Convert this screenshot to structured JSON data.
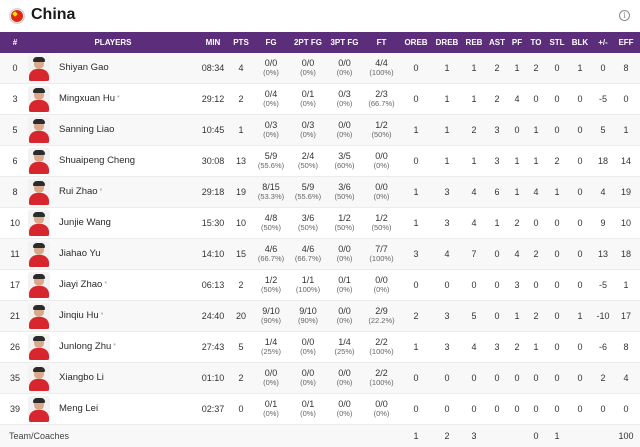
{
  "team": {
    "name": "China",
    "flag_color": "#de2910"
  },
  "columns": [
    "#",
    "PLAYERS",
    "MIN",
    "PTS",
    "FG",
    "2PT FG",
    "3PT FG",
    "FT",
    "OREB",
    "DREB",
    "REB",
    "AST",
    "PF",
    "TO",
    "STL",
    "BLK",
    "+/-",
    "EFF"
  ],
  "players": [
    {
      "num": "0",
      "name": "Shiyan Gao",
      "starter": false,
      "min": "08:34",
      "pts": "4",
      "fg": "0/0",
      "fg_pct": "(0%)",
      "fg2": "0/0",
      "fg2_pct": "(0%)",
      "fg3": "0/0",
      "fg3_pct": "(0%)",
      "ft": "4/4",
      "ft_pct": "(100%)",
      "oreb": "0",
      "dreb": "1",
      "reb": "1",
      "ast": "2",
      "pf": "1",
      "to": "2",
      "stl": "0",
      "blk": "1",
      "pm": "0",
      "eff": "8"
    },
    {
      "num": "3",
      "name": "Mingxuan Hu",
      "starter": true,
      "min": "29:12",
      "pts": "2",
      "fg": "0/4",
      "fg_pct": "(0%)",
      "fg2": "0/1",
      "fg2_pct": "(0%)",
      "fg3": "0/3",
      "fg3_pct": "(0%)",
      "ft": "2/3",
      "ft_pct": "(66.7%)",
      "oreb": "0",
      "dreb": "1",
      "reb": "1",
      "ast": "2",
      "pf": "4",
      "to": "0",
      "stl": "0",
      "blk": "0",
      "pm": "-5",
      "eff": "0"
    },
    {
      "num": "5",
      "name": "Sanning Liao",
      "starter": false,
      "min": "10:45",
      "pts": "1",
      "fg": "0/3",
      "fg_pct": "(0%)",
      "fg2": "0/3",
      "fg2_pct": "(0%)",
      "fg3": "0/0",
      "fg3_pct": "(0%)",
      "ft": "1/2",
      "ft_pct": "(50%)",
      "oreb": "1",
      "dreb": "1",
      "reb": "2",
      "ast": "3",
      "pf": "0",
      "to": "1",
      "stl": "0",
      "blk": "0",
      "pm": "5",
      "eff": "1"
    },
    {
      "num": "6",
      "name": "Shuaipeng Cheng",
      "starter": false,
      "min": "30:08",
      "pts": "13",
      "fg": "5/9",
      "fg_pct": "(55.6%)",
      "fg2": "2/4",
      "fg2_pct": "(50%)",
      "fg3": "3/5",
      "fg3_pct": "(60%)",
      "ft": "0/0",
      "ft_pct": "(0%)",
      "oreb": "0",
      "dreb": "1",
      "reb": "1",
      "ast": "3",
      "pf": "1",
      "to": "1",
      "stl": "2",
      "blk": "0",
      "pm": "18",
      "eff": "14"
    },
    {
      "num": "8",
      "name": "Rui Zhao",
      "starter": true,
      "min": "29:18",
      "pts": "19",
      "fg": "8/15",
      "fg_pct": "(53.3%)",
      "fg2": "5/9",
      "fg2_pct": "(55.6%)",
      "fg3": "3/6",
      "fg3_pct": "(50%)",
      "ft": "0/0",
      "ft_pct": "(0%)",
      "oreb": "1",
      "dreb": "3",
      "reb": "4",
      "ast": "6",
      "pf": "1",
      "to": "4",
      "stl": "1",
      "blk": "0",
      "pm": "4",
      "eff": "19"
    },
    {
      "num": "10",
      "name": "Junjie Wang",
      "starter": false,
      "min": "15:30",
      "pts": "10",
      "fg": "4/8",
      "fg_pct": "(50%)",
      "fg2": "3/6",
      "fg2_pct": "(50%)",
      "fg3": "1/2",
      "fg3_pct": "(50%)",
      "ft": "1/2",
      "ft_pct": "(50%)",
      "oreb": "1",
      "dreb": "3",
      "reb": "4",
      "ast": "1",
      "pf": "2",
      "to": "0",
      "stl": "0",
      "blk": "0",
      "pm": "9",
      "eff": "10"
    },
    {
      "num": "11",
      "name": "Jiahao Yu",
      "starter": false,
      "min": "14:10",
      "pts": "15",
      "fg": "4/6",
      "fg_pct": "(66.7%)",
      "fg2": "4/6",
      "fg2_pct": "(66.7%)",
      "fg3": "0/0",
      "fg3_pct": "(0%)",
      "ft": "7/7",
      "ft_pct": "(100%)",
      "oreb": "3",
      "dreb": "4",
      "reb": "7",
      "ast": "0",
      "pf": "4",
      "to": "2",
      "stl": "0",
      "blk": "0",
      "pm": "13",
      "eff": "18"
    },
    {
      "num": "17",
      "name": "Jiayi Zhao",
      "starter": true,
      "min": "06:13",
      "pts": "2",
      "fg": "1/2",
      "fg_pct": "(50%)",
      "fg2": "1/1",
      "fg2_pct": "(100%)",
      "fg3": "0/1",
      "fg3_pct": "(0%)",
      "ft": "0/0",
      "ft_pct": "(0%)",
      "oreb": "0",
      "dreb": "0",
      "reb": "0",
      "ast": "0",
      "pf": "3",
      "to": "0",
      "stl": "0",
      "blk": "0",
      "pm": "-5",
      "eff": "1"
    },
    {
      "num": "21",
      "name": "Jinqiu Hu",
      "starter": true,
      "min": "24:40",
      "pts": "20",
      "fg": "9/10",
      "fg_pct": "(90%)",
      "fg2": "9/10",
      "fg2_pct": "(90%)",
      "fg3": "0/0",
      "fg3_pct": "(0%)",
      "ft": "2/9",
      "ft_pct": "(22.2%)",
      "oreb": "2",
      "dreb": "3",
      "reb": "5",
      "ast": "0",
      "pf": "1",
      "to": "2",
      "stl": "0",
      "blk": "1",
      "pm": "-10",
      "eff": "17"
    },
    {
      "num": "26",
      "name": "Junlong Zhu",
      "starter": true,
      "min": "27:43",
      "pts": "5",
      "fg": "1/4",
      "fg_pct": "(25%)",
      "fg2": "0/0",
      "fg2_pct": "(0%)",
      "fg3": "1/4",
      "fg3_pct": "(25%)",
      "ft": "2/2",
      "ft_pct": "(100%)",
      "oreb": "1",
      "dreb": "3",
      "reb": "4",
      "ast": "3",
      "pf": "2",
      "to": "1",
      "stl": "0",
      "blk": "0",
      "pm": "-6",
      "eff": "8"
    },
    {
      "num": "35",
      "name": "Xiangbo Li",
      "starter": false,
      "min": "01:10",
      "pts": "2",
      "fg": "0/0",
      "fg_pct": "(0%)",
      "fg2": "0/0",
      "fg2_pct": "(0%)",
      "fg3": "0/0",
      "fg3_pct": "(0%)",
      "ft": "2/2",
      "ft_pct": "(100%)",
      "oreb": "0",
      "dreb": "0",
      "reb": "0",
      "ast": "0",
      "pf": "0",
      "to": "0",
      "stl": "0",
      "blk": "0",
      "pm": "2",
      "eff": "4"
    },
    {
      "num": "39",
      "name": "Meng Lei",
      "starter": false,
      "min": "02:37",
      "pts": "0",
      "fg": "0/1",
      "fg_pct": "(0%)",
      "fg2": "0/1",
      "fg2_pct": "(0%)",
      "fg3": "0/0",
      "fg3_pct": "(0%)",
      "ft": "0/0",
      "ft_pct": "(0%)",
      "oreb": "0",
      "dreb": "0",
      "reb": "0",
      "ast": "0",
      "pf": "0",
      "to": "0",
      "stl": "0",
      "blk": "0",
      "pm": "0",
      "eff": "0"
    }
  ],
  "team_coaches": {
    "label": "Team/Coaches",
    "oreb": "1",
    "dreb": "2",
    "reb": "3",
    "to": "0",
    "stl": "1",
    "eff": "100"
  },
  "colors": {
    "header_bg": "#5b2d7a",
    "jersey": "#d7262d"
  }
}
